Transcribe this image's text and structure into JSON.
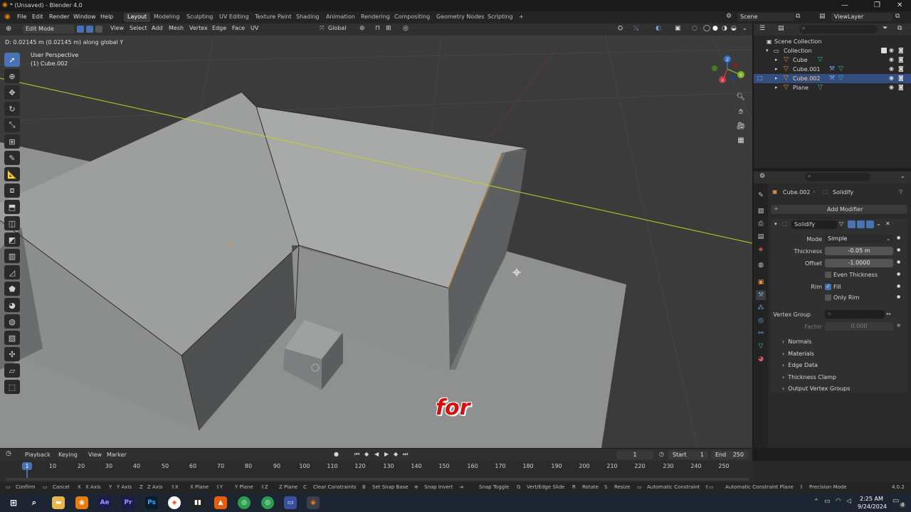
{
  "window": {
    "title": "* (Unsaved) - Blender 4.0",
    "menus": [
      "File",
      "Edit",
      "Render",
      "Window",
      "Help"
    ],
    "workspaces": [
      "Layout",
      "Modeling",
      "Sculpting",
      "UV Editing",
      "Texture Paint",
      "Shading",
      "Animation",
      "Rendering",
      "Compositing",
      "Geometry Nodes",
      "Scripting"
    ],
    "add_workspace": "+",
    "scene": "Scene",
    "view_layer": "ViewLayer"
  },
  "viewport_header": {
    "mode": "Edit Mode",
    "menus": [
      "View",
      "Select",
      "Add",
      "Mesh",
      "Vertex",
      "Edge",
      "Face",
      "UV"
    ],
    "orientation": "Global"
  },
  "viewport": {
    "status_text": "D: 0.02145 m (0.02145 m) along global Y",
    "view_name": "User Perspective",
    "object_name": "(1) Cube.002",
    "caption": "for",
    "gizmo_axes": [
      "X",
      "Y",
      "Z"
    ]
  },
  "outliner": {
    "root": "Scene Collection",
    "collection": "Collection",
    "items": [
      {
        "name": "Cube"
      },
      {
        "name": "Cube.001"
      },
      {
        "name": "Cube.002"
      },
      {
        "name": "Plane"
      }
    ]
  },
  "properties": {
    "breadcrumb_object": "Cube.002",
    "breadcrumb_modifier": "Solidify",
    "add_modifier": "Add Modifier",
    "modifier_name": "Solidify",
    "fields": {
      "mode_label": "Mode",
      "mode_value": "Simple",
      "thickness_label": "Thickness",
      "thickness_value": "-0.05 m",
      "offset_label": "Offset",
      "offset_value": "-1.0000",
      "even_thickness": "Even Thickness",
      "rim_label": "Rim",
      "fill": "Fill",
      "only_rim": "Only Rim",
      "vertex_group_label": "Vertex Group",
      "factor_label": "Factor",
      "factor_value": "0.000"
    },
    "subpanels": [
      "Normals",
      "Materials",
      "Edge Data",
      "Thickness Clamp",
      "Output Vertex Groups"
    ]
  },
  "timeline": {
    "menus": [
      "Playback",
      "Keying",
      "View",
      "Marker"
    ],
    "current_frame": "1",
    "start_label": "Start",
    "start_value": "1",
    "end_label": "End",
    "end_value": "250",
    "playhead": "1",
    "ticks": [
      "10",
      "20",
      "30",
      "40",
      "50",
      "60",
      "70",
      "80",
      "90",
      "100",
      "110",
      "120",
      "130",
      "140",
      "150",
      "160",
      "170",
      "180",
      "190",
      "200",
      "210",
      "220",
      "230",
      "240",
      "250"
    ]
  },
  "statusbar": {
    "items": [
      "Confirm",
      "Cancel",
      "X Axis",
      "Y Axis",
      "Z Axis",
      "X Plane",
      "Y Plane",
      "Z Plane",
      "Clear Constraints",
      "Set Snap Base",
      "Snap Invert",
      "Snap Toggle",
      "Vert/Edge Slide",
      "Rotate",
      "Resize",
      "Automatic Constraint",
      "Automatic Constraint Plane",
      "Precision Mode"
    ],
    "version": "4.0.2"
  },
  "taskbar": {
    "time": "2:25 AM",
    "date": "9/24/2024",
    "notifications": "4",
    "apps": [
      "Ae",
      "Pr",
      "Ps"
    ]
  },
  "colors": {
    "accent": "#4772b3",
    "selected_row": "#334d80",
    "caption": "#d80d0d"
  }
}
